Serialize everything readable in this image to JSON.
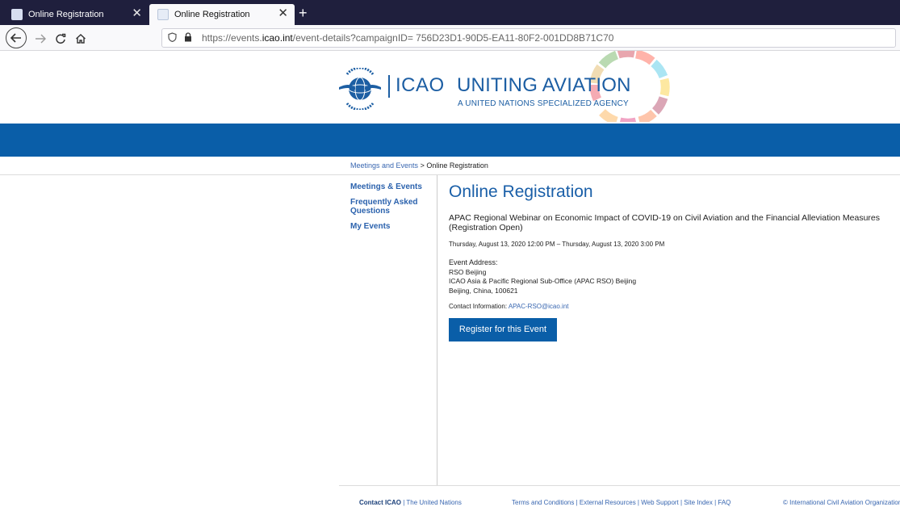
{
  "browser": {
    "tabs": [
      {
        "label": "Online Registration",
        "close": "✕"
      },
      {
        "label": "Online Registration",
        "close": "✕"
      }
    ],
    "new_tab": "+",
    "url_prefix": "https://events.",
    "url_domain": "icao.int",
    "url_rest": "/event-details?campaignID= 756D23D1-90D5-EA11-80F2-001DD8B71C70"
  },
  "header": {
    "logo_name": "ICAO",
    "tagline": "UNITING AVIATION",
    "agency": "A UNITED NATIONS SPECIALIZED AGENCY",
    "colors": {
      "brand_blue": "#0a5ea8",
      "logo_blue": "#1c5ea3"
    }
  },
  "breadcrumb": {
    "link": "Meetings and Events",
    "separator": " > ",
    "current": "Online Registration"
  },
  "sidebar": {
    "items": [
      {
        "label": "Meetings & Events"
      },
      {
        "label": "Frequently Asked Questions"
      },
      {
        "label": "My Events"
      }
    ]
  },
  "main": {
    "title": "Online Registration",
    "event_title": "APAC Regional Webinar on Economic Impact of COVID-19 on Civil Aviation and the Financial Alleviation Measures (Registration Open)",
    "date": "Thursday, August 13, 2020 12:00 PM – Thursday, August 13, 2020 3:00 PM",
    "address_label": "Event Address:",
    "address_lines": [
      "RSO Beijing",
      "ICAO Asia & Pacific Regional Sub-Office (APAC RSO) Beijing",
      "Beijing, China, 100621"
    ],
    "contact_label": "Contact Information:",
    "contact_email": "APAC-RSO@icao.int",
    "register_label": "Register for this Event"
  },
  "footer": {
    "contact_label": "Contact ICAO",
    "un_link": "The United Nations",
    "links": "Terms and Conditions  |  External Resources  |  Web Support  |  Site Index  |  FAQ",
    "copyright": "© International Civil Aviation Organization"
  }
}
